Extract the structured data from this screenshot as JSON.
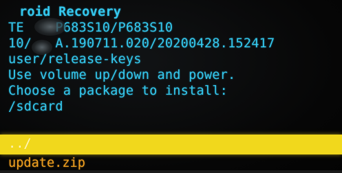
{
  "recovery": {
    "title": "roid Recovery",
    "model_line": "TE    P683S10/P683S10",
    "build_line": "10/   A.190711.020/20200428.152417",
    "keys_line": "user/release-keys",
    "instructions": "Use volume up/down and power.",
    "prompt": "Choose a package to install:",
    "directory": "/sdcard"
  },
  "menu": {
    "items": [
      {
        "label": "../"
      },
      {
        "label": "update.zip"
      }
    ]
  },
  "colors": {
    "header_text": "#34c8ee",
    "selected_bg": "#f1d81c",
    "menu_text": "#f0a020",
    "background": "#070707"
  }
}
